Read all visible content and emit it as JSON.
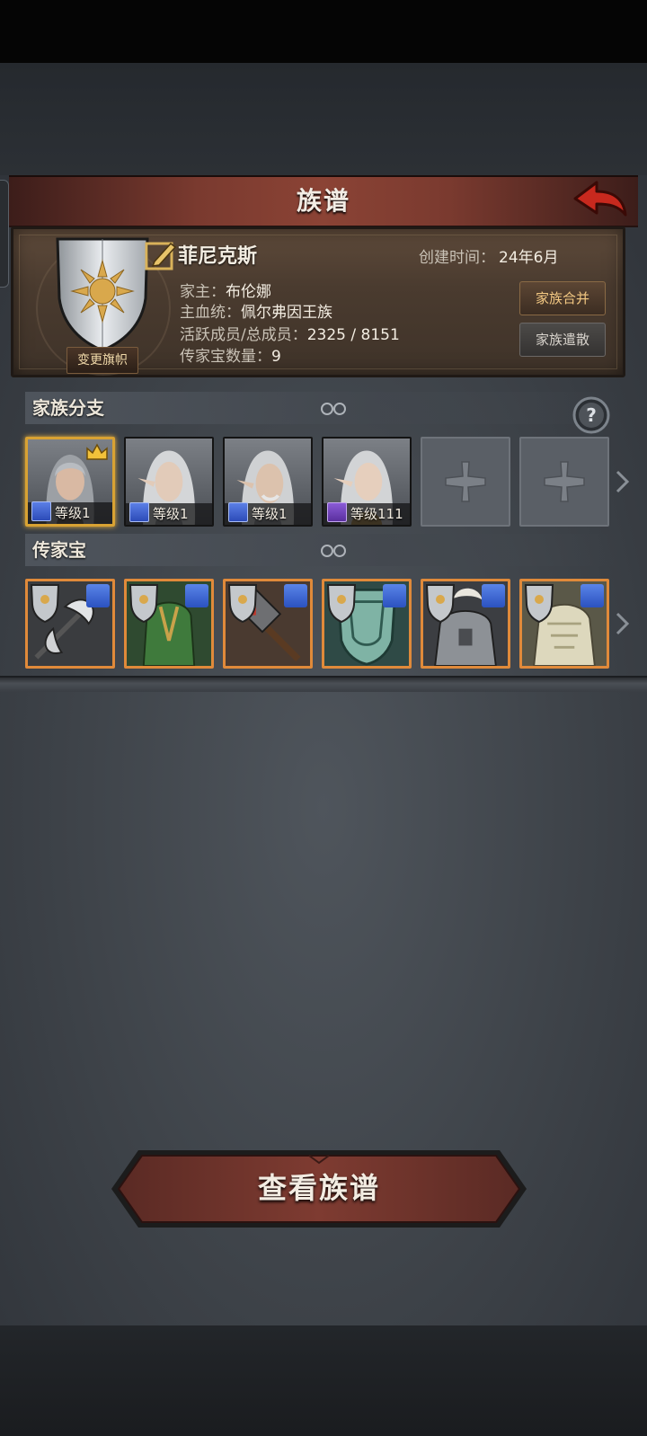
{
  "header": {
    "title": "族谱",
    "back_icon": "back-arrow-icon"
  },
  "family": {
    "name": "菲尼克斯",
    "created_label": "创建时间：",
    "created_value": "24年6月",
    "head_label": "家主：",
    "head_value": "布伦娜",
    "bloodline_label": "主血统：",
    "bloodline_value": "佩尔弗因王族",
    "members_label": "活跃成员/总成员：",
    "members_value": "2325 / 8151",
    "heirloom_count_label": "传家宝数量：",
    "heirloom_count_value": "9",
    "change_flag": "变更旗帜",
    "merge": "家族合并",
    "disband": "家族遣散"
  },
  "branches": {
    "title": "家族分支",
    "members": [
      {
        "level": "等级1",
        "weapon": "sword-icon",
        "selected": true,
        "crown": true
      },
      {
        "level": "等级1",
        "weapon": "sword-icon"
      },
      {
        "level": "等级1",
        "weapon": "sword-icon"
      },
      {
        "level": "等级111",
        "weapon": "staff-icon"
      }
    ],
    "empty_slots": 2
  },
  "heirlooms": {
    "title": "传家宝",
    "items": [
      "halberd",
      "green-armor",
      "warhammer",
      "jade-shield",
      "silver-armor",
      "ivory-armor"
    ]
  },
  "actions": {
    "view_tree": "查看族谱"
  },
  "colors": {
    "accent_gold": "#d8a233",
    "item_border": "#e08a3a",
    "header_red": "#8b4335"
  }
}
